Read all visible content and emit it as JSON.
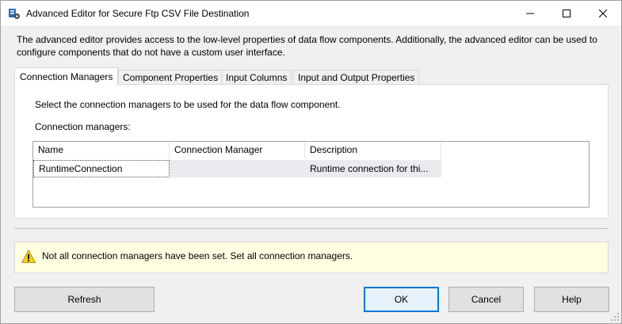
{
  "window": {
    "title": "Advanced Editor for Secure Ftp CSV File Destination"
  },
  "intro": "The advanced editor provides access to the low-level properties of data flow components. Additionally, the advanced editor can be used to configure components that do not have a custom user interface.",
  "tabs": [
    {
      "label": "Connection Managers",
      "active": true
    },
    {
      "label": "Component Properties",
      "active": false
    },
    {
      "label": "Input Columns",
      "active": false
    },
    {
      "label": "Input and Output Properties",
      "active": false
    }
  ],
  "panel": {
    "instruction": "Select the connection managers to be used for the data flow component.",
    "grid_label": "Connection managers:",
    "columns": [
      "Name",
      "Connection Manager",
      "Description"
    ],
    "rows": [
      {
        "name": "RuntimeConnection",
        "connection_manager": "",
        "description": "Runtime connection for thi..."
      }
    ]
  },
  "status": {
    "message": "Not all connection managers have been set. Set all connection managers.",
    "icon": "warning-icon"
  },
  "buttons": {
    "refresh": "Refresh",
    "ok": "OK",
    "cancel": "Cancel",
    "help": "Help"
  },
  "colors": {
    "status_background": "#ffffe1",
    "default_button_border": "#0078d7",
    "row_highlight": "#e9ebef"
  }
}
